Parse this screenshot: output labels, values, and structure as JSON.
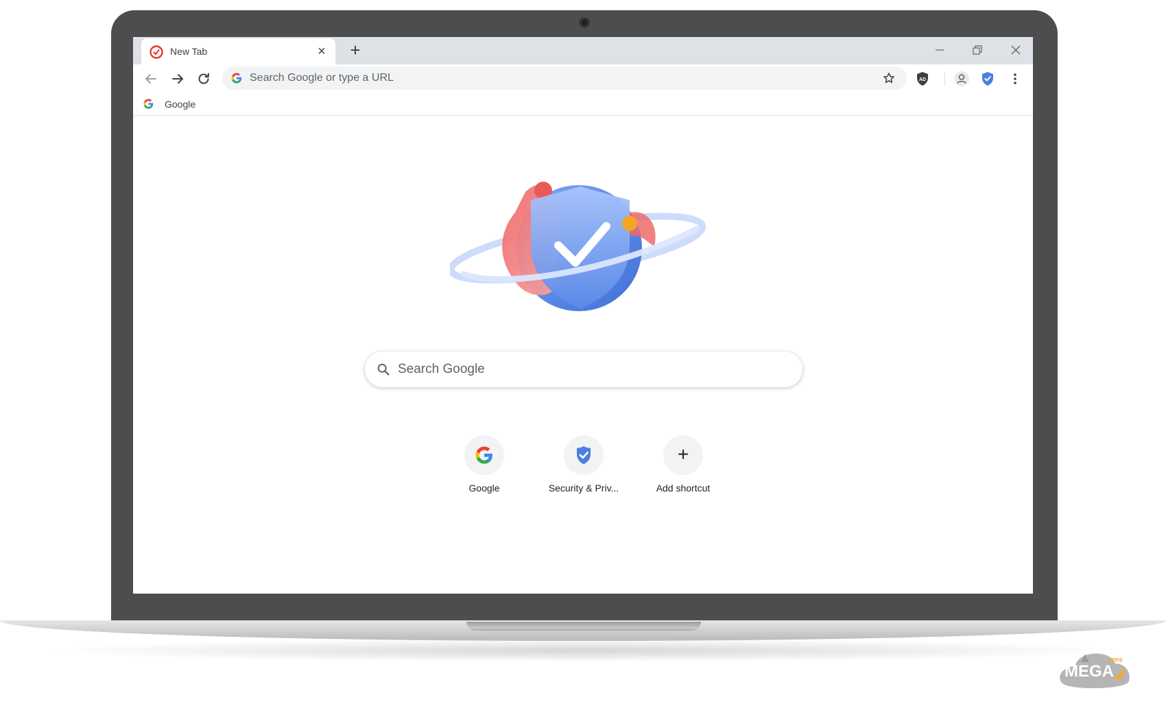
{
  "browser": {
    "tab": {
      "title": "New Tab",
      "close_glyph": "×"
    },
    "new_tab_glyph": "+",
    "omnibox": {
      "placeholder": "Search Google or type a URL"
    },
    "bookmarks": [
      {
        "label": "Google",
        "icon": "google-g-icon"
      }
    ]
  },
  "ntp": {
    "search": {
      "placeholder": "Search Google"
    },
    "shortcuts": [
      {
        "label": "Google",
        "icon": "google-g-icon"
      },
      {
        "label": "Security & Priv...",
        "icon": "shield-check-icon"
      },
      {
        "label": "Add shortcut",
        "icon": "plus-icon",
        "glyph": "+"
      }
    ]
  },
  "watermark": {
    "text": "MEGA",
    "subtext": "APPS"
  },
  "colors": {
    "frame": "#4d4d4d",
    "tabstrip": "#dee1e6",
    "omnibox": "#f1f3f4",
    "accent_blue": "#4a7fe0",
    "google_blue": "#4285f4",
    "google_red": "#ea4335",
    "google_yellow": "#fbbc05",
    "google_green": "#34a853"
  }
}
